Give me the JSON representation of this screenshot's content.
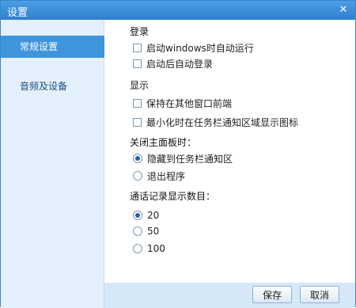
{
  "window": {
    "title": "设置",
    "close_label": "✕"
  },
  "sidebar": {
    "items": [
      {
        "label": "常规设置"
      },
      {
        "label": "音频及设备"
      }
    ]
  },
  "login": {
    "heading": "登录",
    "options": [
      {
        "label": "启动windows时自动运行",
        "checked": false
      },
      {
        "label": "启动后自动登录",
        "checked": false
      }
    ]
  },
  "display": {
    "heading": "显示",
    "options": [
      {
        "label": "保持在其他窗口前端",
        "checked": false
      },
      {
        "label": "最小化时在任务栏通知区域显示图标",
        "checked": false
      }
    ]
  },
  "close_panel": {
    "heading": "关闭主面板时：",
    "options": [
      {
        "label": "隐藏到任务栏通知区",
        "checked": true
      },
      {
        "label": "退出程序",
        "checked": false
      }
    ]
  },
  "call_log": {
    "heading": "通话记录显示数目：",
    "options": [
      {
        "label": "20",
        "checked": true
      },
      {
        "label": "50",
        "checked": false
      },
      {
        "label": "100",
        "checked": false
      }
    ]
  },
  "footer": {
    "save_label": "保存",
    "cancel_label": "取消"
  }
}
